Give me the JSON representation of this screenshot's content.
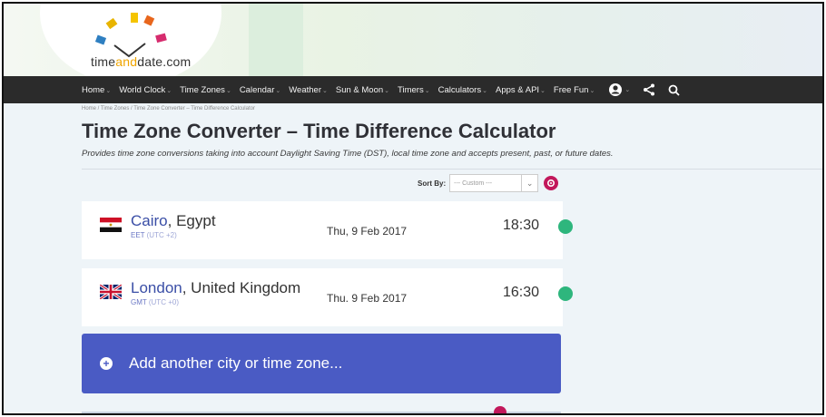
{
  "site": {
    "logo_prefix": "time",
    "logo_middle": "and",
    "logo_suffix": "date.com"
  },
  "nav": {
    "items": [
      {
        "label": "Home",
        "caret": "⌄"
      },
      {
        "label": "World Clock",
        "caret": "⌄"
      },
      {
        "label": "Time Zones",
        "caret": "⌄"
      },
      {
        "label": "Calendar",
        "caret": "⌄"
      },
      {
        "label": "Weather",
        "caret": "⌄"
      },
      {
        "label": "Sun & Moon",
        "caret": "⌄"
      },
      {
        "label": "Timers",
        "caret": "⌄"
      },
      {
        "label": "Calculators",
        "caret": "⌄"
      },
      {
        "label": "Apps & API",
        "caret": "⌄"
      },
      {
        "label": "Free Fun",
        "caret": "⌄"
      }
    ],
    "icons": [
      "account-icon",
      "share-icon",
      "search-icon"
    ]
  },
  "breadcrumb": "Home /  Time Zones /  Time Zone Converter – Time Difference Calculator",
  "page": {
    "title": "Time Zone Converter – Time Difference Calculator",
    "subtitle": "Provides time zone conversions taking into account Daylight Saving Time (DST), local time zone and accepts present, past, or future dates."
  },
  "sort": {
    "label": "Sort By:",
    "value": "--- Custom ---"
  },
  "cities": [
    {
      "name": "Cairo",
      "country": ", Egypt",
      "zone": "EET",
      "utc": " (UTC +2)",
      "date": "Thu, 9 Feb 2017",
      "time": "18:30",
      "flag": "egypt-flag-icon"
    },
    {
      "name": "London",
      "country": ", United Kingdom",
      "zone": "GMT",
      "utc": " (UTC +0)",
      "date": "Thu. 9 Feb 2017",
      "time": "16:30",
      "flag": "uk-flag-icon"
    }
  ],
  "add_city": {
    "label": "Add another city or time zone...",
    "icon": "+"
  },
  "colors": {
    "nav_bg": "#2b2b2b",
    "accent_blue": "#4a5bc4",
    "accent_pink": "#c2185b",
    "status_green": "#2eb67d"
  }
}
